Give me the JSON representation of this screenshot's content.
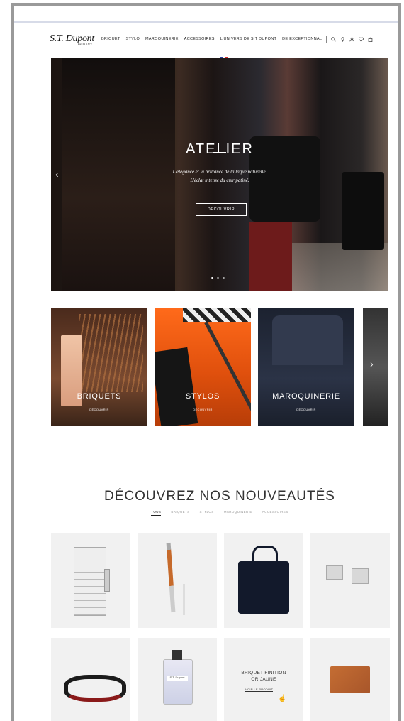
{
  "header": {
    "logo": "S.T. Dupont",
    "logo_sub": "PARIS 1872",
    "nav": [
      "BRIQUET",
      "STYLO",
      "MAROQUINERIE",
      "ACCESSOIRES",
      "L'UNIVERS DE S.T DUPONT",
      "DE EXCEPTIONNAL"
    ],
    "icons": [
      "search-icon",
      "location-icon",
      "account-icon",
      "wishlist-icon",
      "bag-icon"
    ]
  },
  "hero": {
    "title": "ATELIER",
    "line1": "L'élégance et la brillance de la laque naturelle.",
    "line2": "L'éclat intense du cuir patiné.",
    "button": "DÉCOUVRIR",
    "slides": 3,
    "active_slide": 1
  },
  "categories": [
    {
      "label": "BRIQUETS",
      "sub": "DÉCOUVRIR"
    },
    {
      "label": "STYLOS",
      "sub": "DÉCOUVRIR"
    },
    {
      "label": "MAROQUINERIE",
      "sub": "DÉCOUVRIR"
    }
  ],
  "news": {
    "title": "DÉCOUVREZ NOS NOUVEAUTÉS",
    "tabs": [
      "TOUS",
      "BRIQUETS",
      "STYLOS",
      "MAROQUINERIE",
      "ACCESSOIRES"
    ],
    "active_tab": "TOUS"
  },
  "promo": {
    "title_l1": "BRIQUET FINITION",
    "title_l2": "OR JAUNE",
    "link": "VOIR LE PRODUIT"
  },
  "perfume_label": "S.T. Dupont",
  "colors": {
    "accent": "#111111",
    "background": "#ffffff",
    "card": "#f1f1f1"
  }
}
